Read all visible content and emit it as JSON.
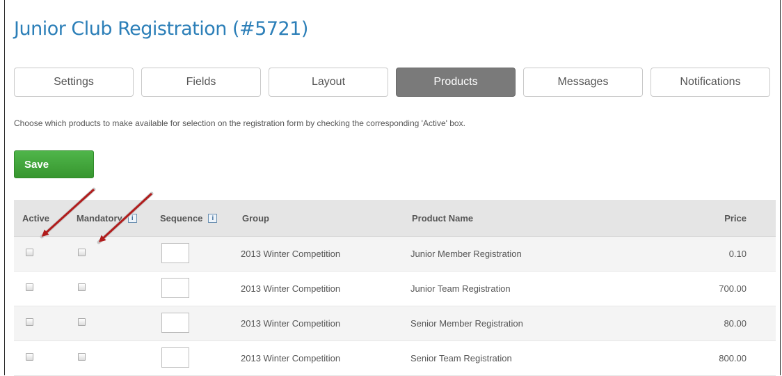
{
  "page": {
    "title": "Junior Club Registration (#5721)"
  },
  "tabs": [
    {
      "label": "Settings",
      "active": false
    },
    {
      "label": "Fields",
      "active": false
    },
    {
      "label": "Layout",
      "active": false
    },
    {
      "label": "Products",
      "active": true
    },
    {
      "label": "Messages",
      "active": false
    },
    {
      "label": "Notifications",
      "active": false
    }
  ],
  "intro": "Choose which products to make available for selection on the registration form by checking the corresponding 'Active' box.",
  "save_label": "Save",
  "table": {
    "headers": {
      "active": "Active",
      "mandatory": "Mandatory",
      "sequence": "Sequence",
      "group": "Group",
      "product": "Product Name",
      "price": "Price"
    },
    "info_icon": "i",
    "rows": [
      {
        "group": "2013 Winter Competition",
        "product": "Junior Member Registration",
        "price": "0.10"
      },
      {
        "group": "2013 Winter Competition",
        "product": "Junior Team Registration",
        "price": "700.00"
      },
      {
        "group": "2013 Winter Competition",
        "product": "Senior Member Registration",
        "price": "80.00"
      },
      {
        "group": "2013 Winter Competition",
        "product": "Senior Team Registration",
        "price": "800.00"
      }
    ]
  },
  "colors": {
    "title": "#2c7fb8",
    "save": "#3fa338",
    "tab_active": "#7a7a7a",
    "arrow": "#b11c1c"
  }
}
